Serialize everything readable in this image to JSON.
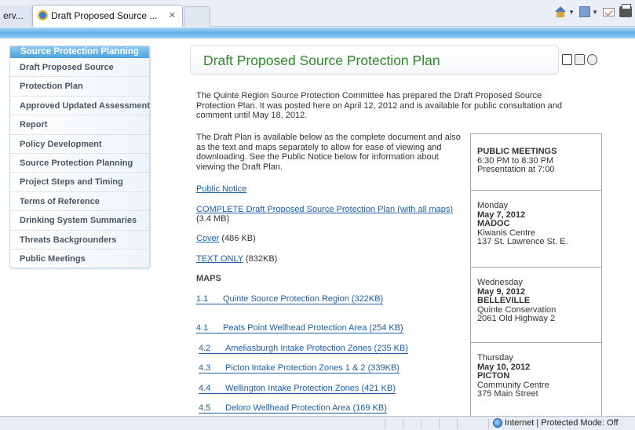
{
  "browser": {
    "prev_tab_label": "erv...",
    "active_tab_label": "Draft Proposed Source ...",
    "tab_close": "✕",
    "toolbar_icons": [
      "home-icon",
      "feed-icon",
      "mail-icon",
      "print-icon"
    ]
  },
  "sidebar": {
    "heading": "Source Protection Planning",
    "items": [
      {
        "label": "Draft Proposed Source"
      },
      {
        "label": "Protection Plan"
      },
      {
        "label": "Approved Updated Assessment"
      },
      {
        "label": "Report"
      },
      {
        "label": "Policy Development"
      },
      {
        "label": "Source Protection Planning"
      },
      {
        "label": "Project Steps and Timing"
      },
      {
        "label": "Terms of Reference"
      },
      {
        "label": "Drinking System Summaries"
      },
      {
        "label": "Threats Backgrounders"
      },
      {
        "label": "Public Meetings"
      }
    ]
  },
  "main": {
    "title": "Draft Proposed Source Protection Plan",
    "intro": "The Quinte Region Source Protection Committee has prepared the Draft Proposed Source Protection Plan. It was posted here on April 12, 2012 and is available for public consultation and comment until May 18, 2012.",
    "availability": "The Draft Plan is available below as the complete document and also as the text and maps separately to allow for ease of viewing and downloading. See the Public Notice below for information about viewing the Draft Plan.",
    "public_notice": "Public Notice",
    "complete_link": "COMPLETE Draft Proposed Source Protection Plan (with all maps)",
    "complete_size": "(3.4 MB)",
    "cover_link": "Cover",
    "cover_size": " (486 KB)",
    "text_link": "TEXT ONLY",
    "text_size": " (832KB)",
    "maps_heading": "MAPS",
    "maps": [
      {
        "num": "1.1",
        "name": "Quinte Source Protection Region (322KB)"
      },
      {
        "num": "4.1",
        "name": "Peats Point Wellhead Protection Area (254 KB)"
      },
      {
        "num": "4.2",
        "name": "Ameliasburgh Intake Protection Zones (235 KB)"
      },
      {
        "num": "4.3",
        "name": "Picton Intake Protection Zones 1 & 2 (339KB)"
      },
      {
        "num": "4.4",
        "name": "Wellington Intake Protection Zones (421 KB)"
      },
      {
        "num": "4.5",
        "name": "Deloro Wellhead Protection Area (169 KB)"
      }
    ]
  },
  "meetings": {
    "heading": "PUBLIC MEETINGS",
    "time": "6:30 PM to 8:30 PM",
    "presentation": "Presentation at 7:00",
    "events": [
      {
        "day": "Monday",
        "date": "May 7, 2012",
        "town": "MADOC",
        "venue": "Kiwanis Centre",
        "address": "137 St. Lawrence St. E."
      },
      {
        "day": "Wednesday",
        "date": "May 9, 2012",
        "town": "BELLEVILLE",
        "venue": "Quinte Conservation",
        "address": "2061 Old Highway 2"
      },
      {
        "day": "Thursday",
        "date": "May 10, 2012",
        "town": "PICTON",
        "venue": "Community Centre",
        "address": "375 Main Street"
      }
    ]
  },
  "status": {
    "zone": "Internet | Protected Mode: Off"
  }
}
